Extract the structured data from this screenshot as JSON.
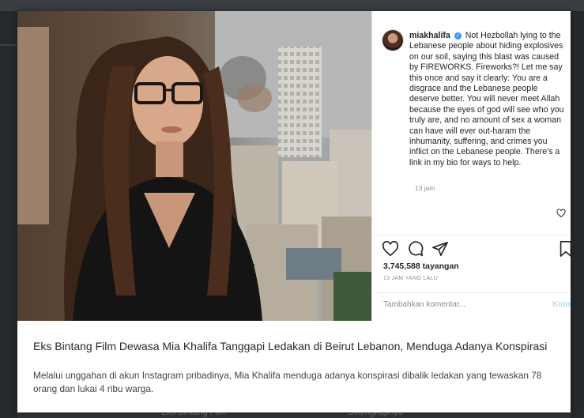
{
  "background": {
    "bottom_left_text": "Eks Bintang Film",
    "bottom_right_text": "Selengkapnya"
  },
  "instagram": {
    "username": "miakhalifa",
    "caption": "Not Hezbollah lying to the Lebanese people about hiding explosives on our soil, saying this blast was caused by FIREWORKS. Fireworks?! Let me say this once and say it clearly: You are a disgrace and the Lebanese people deserve better. You will never meet Allah because the eyes of god will see who you truly are, and no amount of sex a woman can have will ever out-haram the inhumanity, suffering, and crimes you inflict on the Lebanese people. There's a link in my bio for ways to help.",
    "comment_time": "13 jam",
    "views": "3,745,588 tayangan",
    "posted_ago": "13 JAM YANG LALU",
    "comment_placeholder": "Tambahkan komentar...",
    "post_label": "Kirim"
  },
  "article": {
    "headline": "Eks Bintang Film Dewasa Mia Khalifa Tanggapi Ledakan di Beirut Lebanon, Menduga Adanya Konspirasi",
    "summary": "Melalui unggahan di akun Instagram pribadinya, Mia Khalifa menduga adanya konspirasi dibalik ledakan yang tewaskan 78 orang dan lukai 4 ribu warga."
  },
  "icons": {
    "verified": "verified-badge-icon",
    "like": "heart-icon",
    "comment": "comment-icon",
    "share": "share-icon",
    "save": "bookmark-icon"
  },
  "colors": {
    "verified_blue": "#3897f0",
    "page_bg": "#2f3236"
  }
}
